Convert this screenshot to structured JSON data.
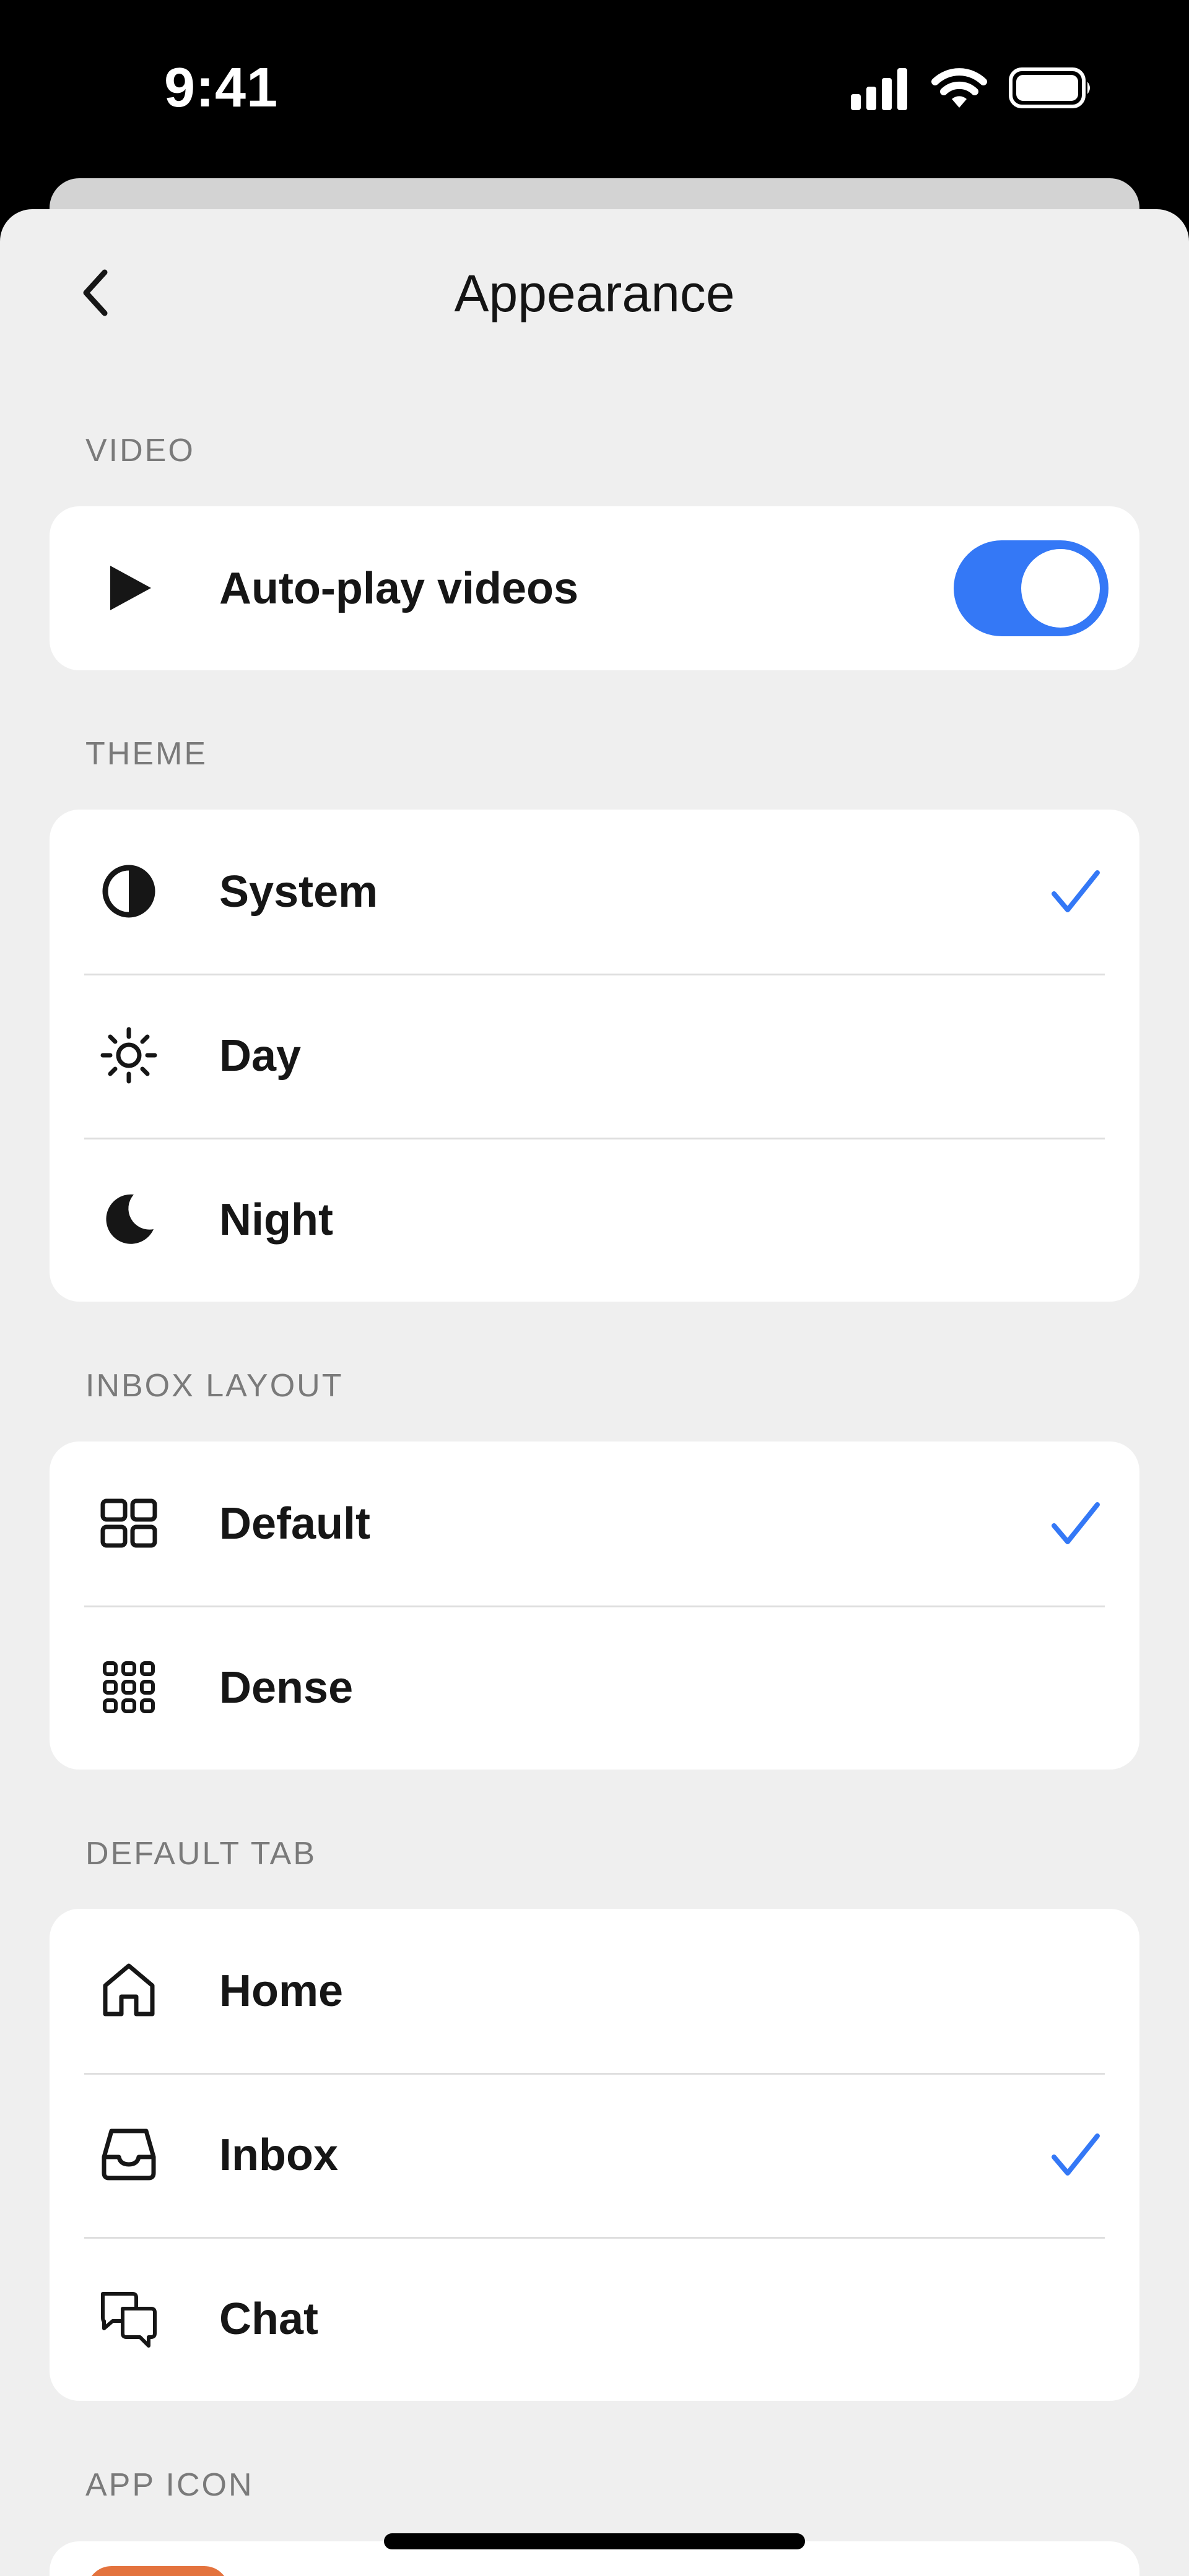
{
  "status_bar": {
    "time": "9:41",
    "icons": [
      "signal-icon",
      "wifi-icon",
      "battery-icon"
    ]
  },
  "header": {
    "title": "Appearance",
    "back_icon": "chevron-left-icon"
  },
  "colors": {
    "accent": "#3478f6",
    "background": "#efefef",
    "card": "#ffffff",
    "section_label": "#7a7a7a"
  },
  "sections": {
    "video": {
      "label": "VIDEO",
      "items": [
        {
          "label": "Auto-play videos",
          "icon": "play-icon",
          "toggle_on": true
        }
      ]
    },
    "theme": {
      "label": "THEME",
      "items": [
        {
          "label": "System",
          "icon": "half-circle-icon",
          "selected": true
        },
        {
          "label": "Day",
          "icon": "sun-icon",
          "selected": false
        },
        {
          "label": "Night",
          "icon": "moon-icon",
          "selected": false
        }
      ]
    },
    "inbox_layout": {
      "label": "INBOX LAYOUT",
      "items": [
        {
          "label": "Default",
          "icon": "grid-2x2-icon",
          "selected": true
        },
        {
          "label": "Dense",
          "icon": "grid-3x3-icon",
          "selected": false
        }
      ]
    },
    "default_tab": {
      "label": "DEFAULT TAB",
      "items": [
        {
          "label": "Home",
          "icon": "home-icon",
          "selected": false
        },
        {
          "label": "Inbox",
          "icon": "inbox-tray-icon",
          "selected": true
        },
        {
          "label": "Chat",
          "icon": "chat-bubbles-icon",
          "selected": false
        }
      ]
    },
    "app_icon": {
      "label": "APP ICON"
    }
  }
}
